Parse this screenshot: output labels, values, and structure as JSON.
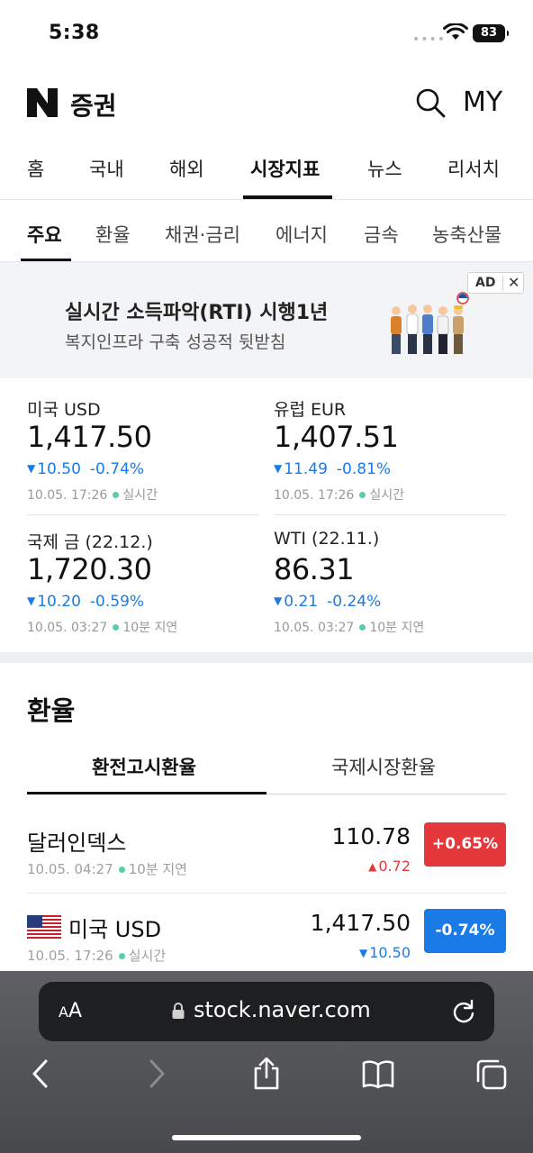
{
  "status": {
    "time": "5:38",
    "battery": "83"
  },
  "header": {
    "title": "증권",
    "my": "MY"
  },
  "main_tabs": [
    {
      "label": "홈"
    },
    {
      "label": "국내"
    },
    {
      "label": "해외"
    },
    {
      "label": "시장지표"
    },
    {
      "label": "뉴스"
    },
    {
      "label": "리서치"
    }
  ],
  "main_tab_active": "시장지표",
  "sub_tabs": [
    {
      "label": "주요"
    },
    {
      "label": "환율"
    },
    {
      "label": "채권·금리"
    },
    {
      "label": "에너지"
    },
    {
      "label": "금속"
    },
    {
      "label": "농축산물"
    }
  ],
  "sub_tab_active": "주요",
  "ad": {
    "title": "실시간 소득파악(RTI) 시행1년",
    "subtitle": "복지인프라 구축 성공적 뒷받침",
    "badge": "AD",
    "close": "✕"
  },
  "quotes": [
    {
      "name": "미국 USD",
      "price": "1,417.50",
      "arrow": "▼",
      "change": "10.50",
      "percent": "-0.74%",
      "date": "10.05. 17:26",
      "status": "실시간"
    },
    {
      "name": "유럽 EUR",
      "price": "1,407.51",
      "arrow": "▼",
      "change": "11.49",
      "percent": "-0.81%",
      "date": "10.05. 17:26",
      "status": "실시간"
    },
    {
      "name": "국제 금 (22.12.)",
      "price": "1,720.30",
      "arrow": "▼",
      "change": "10.20",
      "percent": "-0.59%",
      "date": "10.05. 03:27",
      "status": "10분 지연"
    },
    {
      "name": "WTI (22.11.)",
      "price": "86.31",
      "arrow": "▼",
      "change": "0.21",
      "percent": "-0.24%",
      "date": "10.05. 03:27",
      "status": "10분 지연"
    }
  ],
  "fx": {
    "title": "환율",
    "tabs": [
      {
        "label": "환전고시환율"
      },
      {
        "label": "국제시장환율"
      }
    ],
    "active_tab": "환전고시환율",
    "rows": [
      {
        "name": "달러인덱스",
        "date": "10.05. 04:27",
        "status": "10분 지연",
        "value": "110.78",
        "arrow": "▲",
        "change": "0.72",
        "percent": "+0.65%",
        "color": "#e5383b"
      },
      {
        "name": "미국 USD",
        "date": "10.05. 17:26",
        "status": "실시간",
        "value": "1,417.50",
        "arrow": "▼",
        "change": "10.50",
        "percent": "-0.74%",
        "color": "#1a7be6"
      }
    ]
  },
  "browser": {
    "aa_small": "A",
    "aa_large": "A",
    "url": "stock.naver.com"
  },
  "colors": {
    "down": "#1a7be6",
    "up": "#e5383b",
    "live_dot": "#5ccda7"
  }
}
